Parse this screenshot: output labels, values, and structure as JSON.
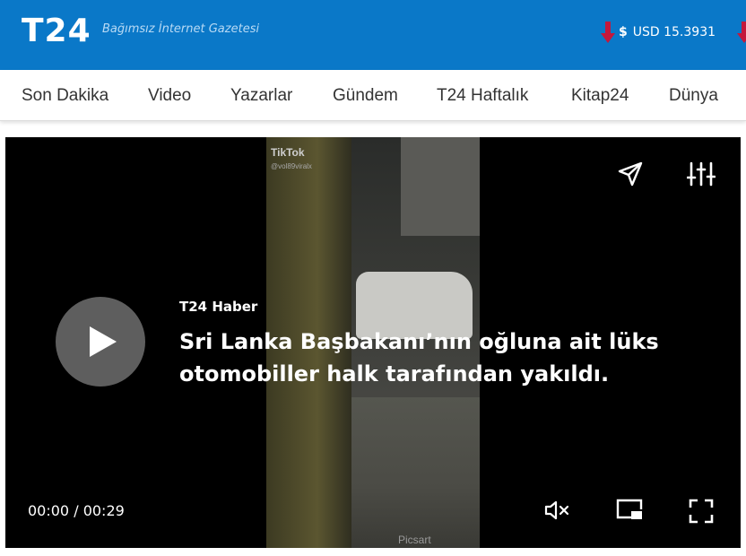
{
  "header": {
    "logo": "T24",
    "tagline": "Bağımsız İnternet Gazetesi",
    "currency_symbol": "$",
    "currency_text": "USD 15.3931",
    "colors": {
      "brand": "#0a78c8",
      "down_arrow": "#c4183c"
    }
  },
  "nav": {
    "items": [
      "Son Dakika",
      "Video",
      "Yazarlar",
      "Gündem",
      "T24 Haftalık",
      "Kitap24",
      "Dünya"
    ]
  },
  "video": {
    "watermark": "TikTok",
    "watermark_user": "@vol89viralx",
    "overlay_watermark": "Picsart",
    "source": "T24 Haber",
    "title_line1": "Sri Lanka Başbakanı’nın oğluna ait lüks",
    "title_line2": "otomobiller halk tarafından yakıldı.",
    "time_current": "00:00",
    "time_separator": "/",
    "time_total": "00:29",
    "icons": {
      "share": "send-icon",
      "settings": "sliders-icon",
      "play": "play-icon",
      "mute": "volume-muted-icon",
      "pip": "picture-in-picture-icon",
      "fullscreen": "fullscreen-icon"
    }
  }
}
